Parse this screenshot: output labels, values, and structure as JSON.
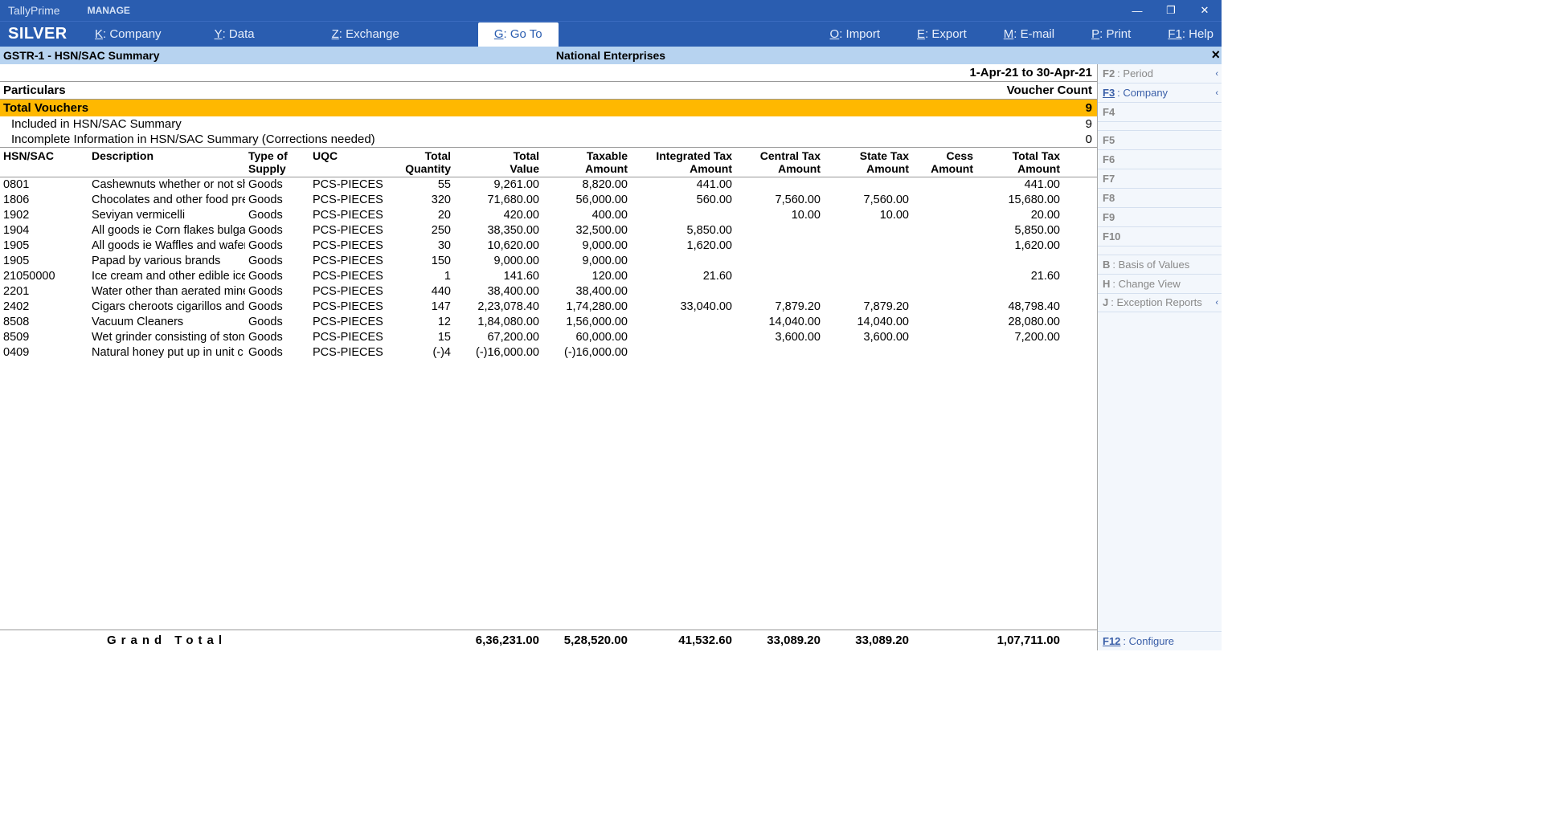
{
  "titlebar": {
    "product": "TallyPrime",
    "manage": "MANAGE"
  },
  "edition": "SILVER",
  "topmenu": [
    {
      "k": "K",
      "l": "Company"
    },
    {
      "k": "Y",
      "l": "Data"
    },
    {
      "k": "Z",
      "l": "Exchange"
    },
    {
      "k": "G",
      "l": "Go To",
      "active": true
    },
    {
      "k": "O",
      "l": "Import"
    },
    {
      "k": "E",
      "l": "Export"
    },
    {
      "k": "M",
      "l": "E-mail"
    },
    {
      "k": "P",
      "l": "Print"
    },
    {
      "k": "F1",
      "l": "Help"
    }
  ],
  "report": {
    "title": "GSTR-1  -  HSN/SAC Summary",
    "company": "National Enterprises",
    "period": "1-Apr-21 to 30-Apr-21",
    "particulars_label": "Particulars",
    "voucher_count_label": "Voucher Count",
    "total_vouchers_label": "Total Vouchers",
    "total_vouchers_count": "9",
    "included_label": "Included in HSN/SAC Summary",
    "included_count": "9",
    "incomplete_label": "Incomplete Information in HSN/SAC Summary (Corrections needed)",
    "incomplete_count": "0"
  },
  "columns": {
    "hsn": "HSN/SAC",
    "desc": "Description",
    "type1": "Type of",
    "type2": "Supply",
    "uqc": "UQC",
    "qty1": "Total",
    "qty2": "Quantity",
    "val1": "Total",
    "val2": "Value",
    "taxv1": "Taxable",
    "taxv2": "Amount",
    "itax1": "Integrated Tax",
    "itax2": "Amount",
    "ctax1": "Central Tax",
    "ctax2": "Amount",
    "stax1": "State Tax",
    "stax2": "Amount",
    "cess1": "Cess",
    "cess2": "Amount",
    "tot1": "Total Tax",
    "tot2": "Amount"
  },
  "rows": [
    {
      "hsn": "0801",
      "desc": "Cashewnuts whether or not shel",
      "type": "Goods",
      "uqc": "PCS-PIECES",
      "qty": "55",
      "val": "9,261.00",
      "taxv": "8,820.00",
      "itax": "441.00",
      "ctax": "",
      "stax": "",
      "cess": "",
      "tot": "441.00"
    },
    {
      "hsn": "1806",
      "desc": "Chocolates and other food prep",
      "type": "Goods",
      "uqc": "PCS-PIECES",
      "qty": "320",
      "val": "71,680.00",
      "taxv": "56,000.00",
      "itax": "560.00",
      "ctax": "7,560.00",
      "stax": "7,560.00",
      "cess": "",
      "tot": "15,680.00"
    },
    {
      "hsn": "1902",
      "desc": "Seviyan vermicelli",
      "type": "Goods",
      "uqc": "PCS-PIECES",
      "qty": "20",
      "val": "420.00",
      "taxv": "400.00",
      "itax": "",
      "ctax": "10.00",
      "stax": "10.00",
      "cess": "",
      "tot": "20.00"
    },
    {
      "hsn": "1904",
      "desc": "All goods ie Corn flakes bulga",
      "type": "Goods",
      "uqc": "PCS-PIECES",
      "qty": "250",
      "val": "38,350.00",
      "taxv": "32,500.00",
      "itax": "5,850.00",
      "ctax": "",
      "stax": "",
      "cess": "",
      "tot": "5,850.00"
    },
    {
      "hsn": "1905",
      "desc": "All goods ie Waffles and wafer",
      "type": "Goods",
      "uqc": "PCS-PIECES",
      "qty": "30",
      "val": "10,620.00",
      "taxv": "9,000.00",
      "itax": "1,620.00",
      "ctax": "",
      "stax": "",
      "cess": "",
      "tot": "1,620.00"
    },
    {
      "hsn": "1905",
      "desc": "Papad by various brands",
      "type": "Goods",
      "uqc": "PCS-PIECES",
      "qty": "150",
      "val": "9,000.00",
      "taxv": "9,000.00",
      "itax": "",
      "ctax": "",
      "stax": "",
      "cess": "",
      "tot": ""
    },
    {
      "hsn": "21050000",
      "desc": "Ice cream and other edible ice",
      "type": "Goods",
      "uqc": "PCS-PIECES",
      "qty": "1",
      "val": "141.60",
      "taxv": "120.00",
      "itax": "21.60",
      "ctax": "",
      "stax": "",
      "cess": "",
      "tot": "21.60"
    },
    {
      "hsn": "2201",
      "desc": "Water other than aerated miner",
      "type": "Goods",
      "uqc": "PCS-PIECES",
      "qty": "440",
      "val": "38,400.00",
      "taxv": "38,400.00",
      "itax": "",
      "ctax": "",
      "stax": "",
      "cess": "",
      "tot": ""
    },
    {
      "hsn": "2402",
      "desc": "Cigars cheroots cigarillos and",
      "type": "Goods",
      "uqc": "PCS-PIECES",
      "qty": "147",
      "val": "2,23,078.40",
      "taxv": "1,74,280.00",
      "itax": "33,040.00",
      "ctax": "7,879.20",
      "stax": "7,879.20",
      "cess": "",
      "tot": "48,798.40"
    },
    {
      "hsn": "8508",
      "desc": "Vacuum Cleaners",
      "type": "Goods",
      "uqc": "PCS-PIECES",
      "qty": "12",
      "val": "1,84,080.00",
      "taxv": "1,56,000.00",
      "itax": "",
      "ctax": "14,040.00",
      "stax": "14,040.00",
      "cess": "",
      "tot": "28,080.00"
    },
    {
      "hsn": "8509",
      "desc": "Wet grinder consisting of ston",
      "type": "Goods",
      "uqc": "PCS-PIECES",
      "qty": "15",
      "val": "67,200.00",
      "taxv": "60,000.00",
      "itax": "",
      "ctax": "3,600.00",
      "stax": "3,600.00",
      "cess": "",
      "tot": "7,200.00"
    },
    {
      "hsn": "0409",
      "desc": "Natural honey put up in unit c",
      "type": "Goods",
      "uqc": "PCS-PIECES",
      "qty": "(-)4",
      "val": "(-)16,000.00",
      "taxv": "(-)16,000.00",
      "itax": "",
      "ctax": "",
      "stax": "",
      "cess": "",
      "tot": ""
    }
  ],
  "grand": {
    "label": "Grand Total",
    "val": "6,36,231.00",
    "taxv": "5,28,520.00",
    "itax": "41,532.60",
    "ctax": "33,089.20",
    "stax": "33,089.20",
    "cess": "",
    "tot": "1,07,711.00"
  },
  "side": {
    "f2": {
      "k": "F2",
      "l": "Period"
    },
    "f3": {
      "k": "F3",
      "l": "Company"
    },
    "f4": {
      "k": "F4",
      "l": ""
    },
    "f5": {
      "k": "F5",
      "l": ""
    },
    "f6": {
      "k": "F6",
      "l": ""
    },
    "f7": {
      "k": "F7",
      "l": ""
    },
    "f8": {
      "k": "F8",
      "l": ""
    },
    "f9": {
      "k": "F9",
      "l": ""
    },
    "f10": {
      "k": "F10",
      "l": ""
    },
    "b": {
      "k": "B",
      "l": "Basis of Values"
    },
    "h": {
      "k": "H",
      "l": "Change View"
    },
    "j": {
      "k": "J",
      "l": "Exception Reports"
    },
    "f12": {
      "k": "F12",
      "l": "Configure"
    }
  }
}
